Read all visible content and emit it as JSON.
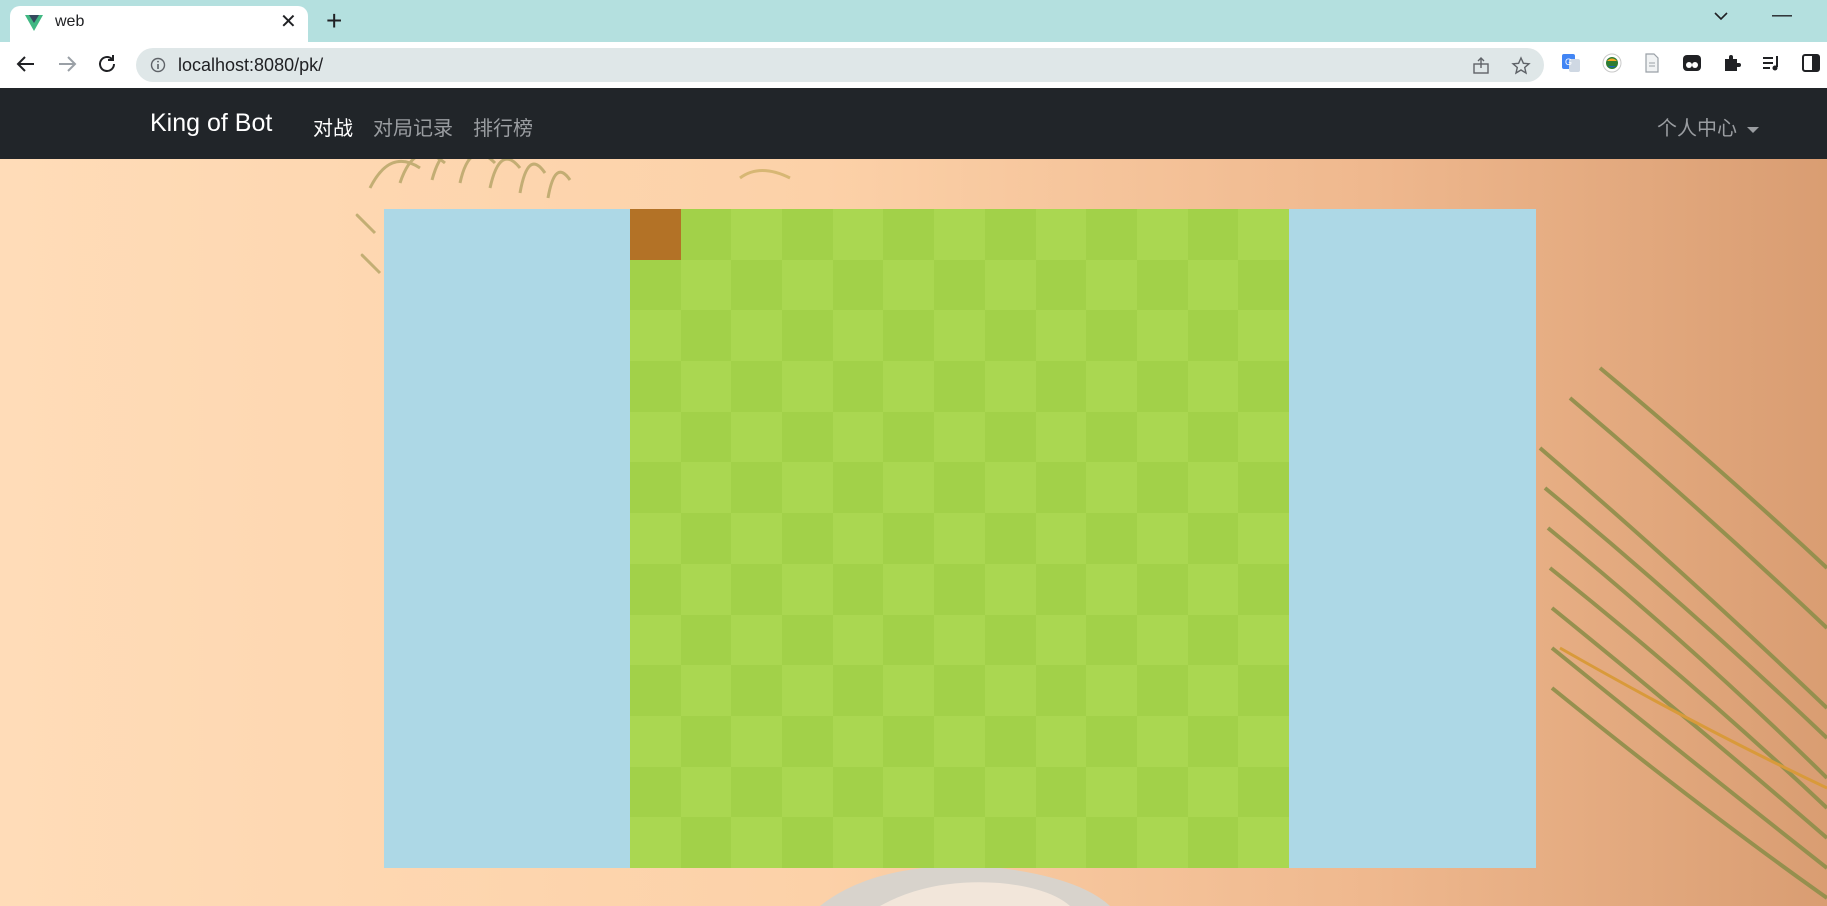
{
  "browser": {
    "tab": {
      "title": "web",
      "favicon": "vue-logo-icon",
      "close_glyph": "✕"
    },
    "new_tab_glyph": "+",
    "minimize_glyph": "—",
    "address_bar": {
      "url": "localhost:8080/pk/"
    },
    "nav_icons": [
      "back-arrow-icon",
      "forward-arrow-icon",
      "reload-icon"
    ],
    "omnibox_icons": [
      "share-icon",
      "star-bookmark-icon"
    ],
    "extension_icons": [
      "google-translate-icon",
      "globe-extension-icon",
      "document-icon",
      "tampermonkey-icon",
      "puzzle-extensions-icon",
      "media-queue-icon",
      "side-panel-icon"
    ]
  },
  "navbar": {
    "brand": "King of Bot",
    "links": [
      {
        "label": "对战",
        "active": true
      },
      {
        "label": "对局记录",
        "active": false
      },
      {
        "label": "排行榜",
        "active": false
      }
    ],
    "user_menu": "个人中心"
  },
  "game": {
    "rows": 13,
    "cols": 13,
    "colors": {
      "background": "#add8e6",
      "grass_light": "#aad751",
      "grass_dark": "#a2d149",
      "wall": "#b37226"
    },
    "walls": [
      {
        "row": 0,
        "col": 0
      }
    ]
  }
}
